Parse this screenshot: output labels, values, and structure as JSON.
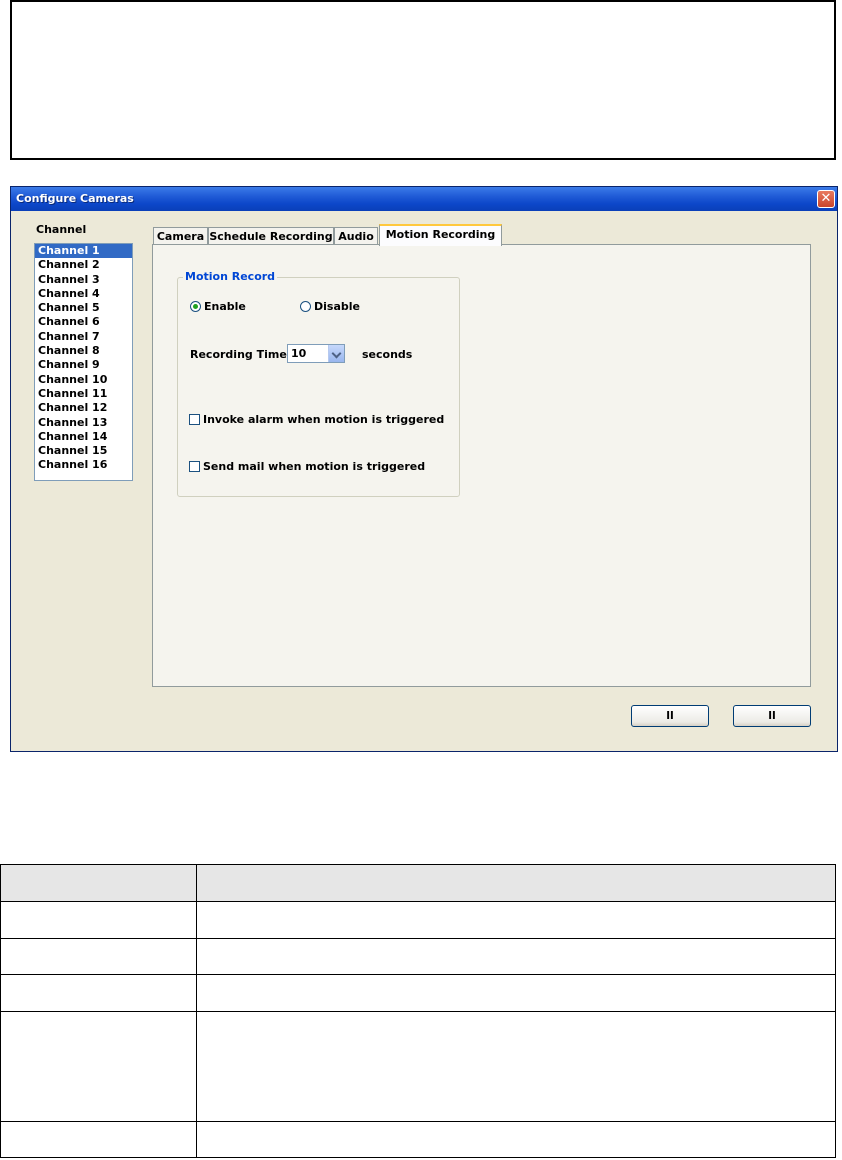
{
  "dialog": {
    "title": "Configure Cameras",
    "close_glyph": "✕"
  },
  "channels": {
    "label": "Channel",
    "items": [
      "Channel 1",
      "Channel 2",
      "Channel 3",
      "Channel 4",
      "Channel 5",
      "Channel 6",
      "Channel 7",
      "Channel 8",
      "Channel 9",
      "Channel 10",
      "Channel 11",
      "Channel 12",
      "Channel 13",
      "Channel 14",
      "Channel 15",
      "Channel 16"
    ],
    "selected_index": 0
  },
  "tabs": {
    "items": [
      "Camera",
      "Schedule Recording",
      "Audio",
      "Motion Recording"
    ],
    "active_index": 3
  },
  "motion_record": {
    "group_title": "Motion Record",
    "enable_label": "Enable",
    "disable_label": "Disable",
    "enabled": true,
    "recording_time_label": "Recording Time",
    "recording_time_value": "10",
    "seconds_label": "seconds",
    "invoke_alarm_label": "Invoke alarm when motion is triggered",
    "invoke_alarm_checked": false,
    "send_mail_label": "Send mail when motion is triggered",
    "send_mail_checked": false
  },
  "buttons": {
    "ok_label": "ll",
    "cancel_label": "ll"
  },
  "colors": {
    "titlebar": "#0c47c9",
    "dialog_bg": "#ece9d8",
    "selection": "#316ac5",
    "group_title": "#0046d5"
  }
}
